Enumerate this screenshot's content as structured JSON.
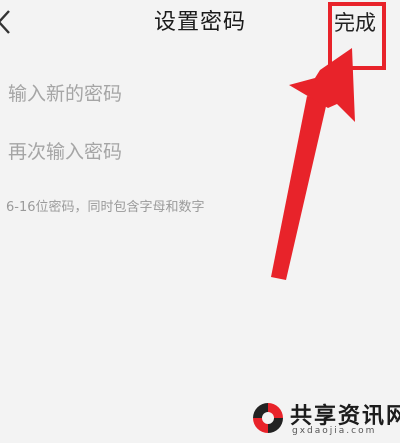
{
  "header": {
    "title": "设置密码",
    "done_label": "完成",
    "back_icon": "chevron-left-icon"
  },
  "form": {
    "new_password_placeholder": "输入新的密码",
    "confirm_password_placeholder": "再次输入密码",
    "hint": "6-16位密码，同时包含字母和数字"
  },
  "annotation": {
    "highlight_color": "#e8232a",
    "arrow_color": "#e8232a"
  },
  "watermark": {
    "text": "共享资讯网",
    "url": "gxdaojia.com",
    "logo_colors": [
      "#e8232a",
      "#222222"
    ]
  }
}
